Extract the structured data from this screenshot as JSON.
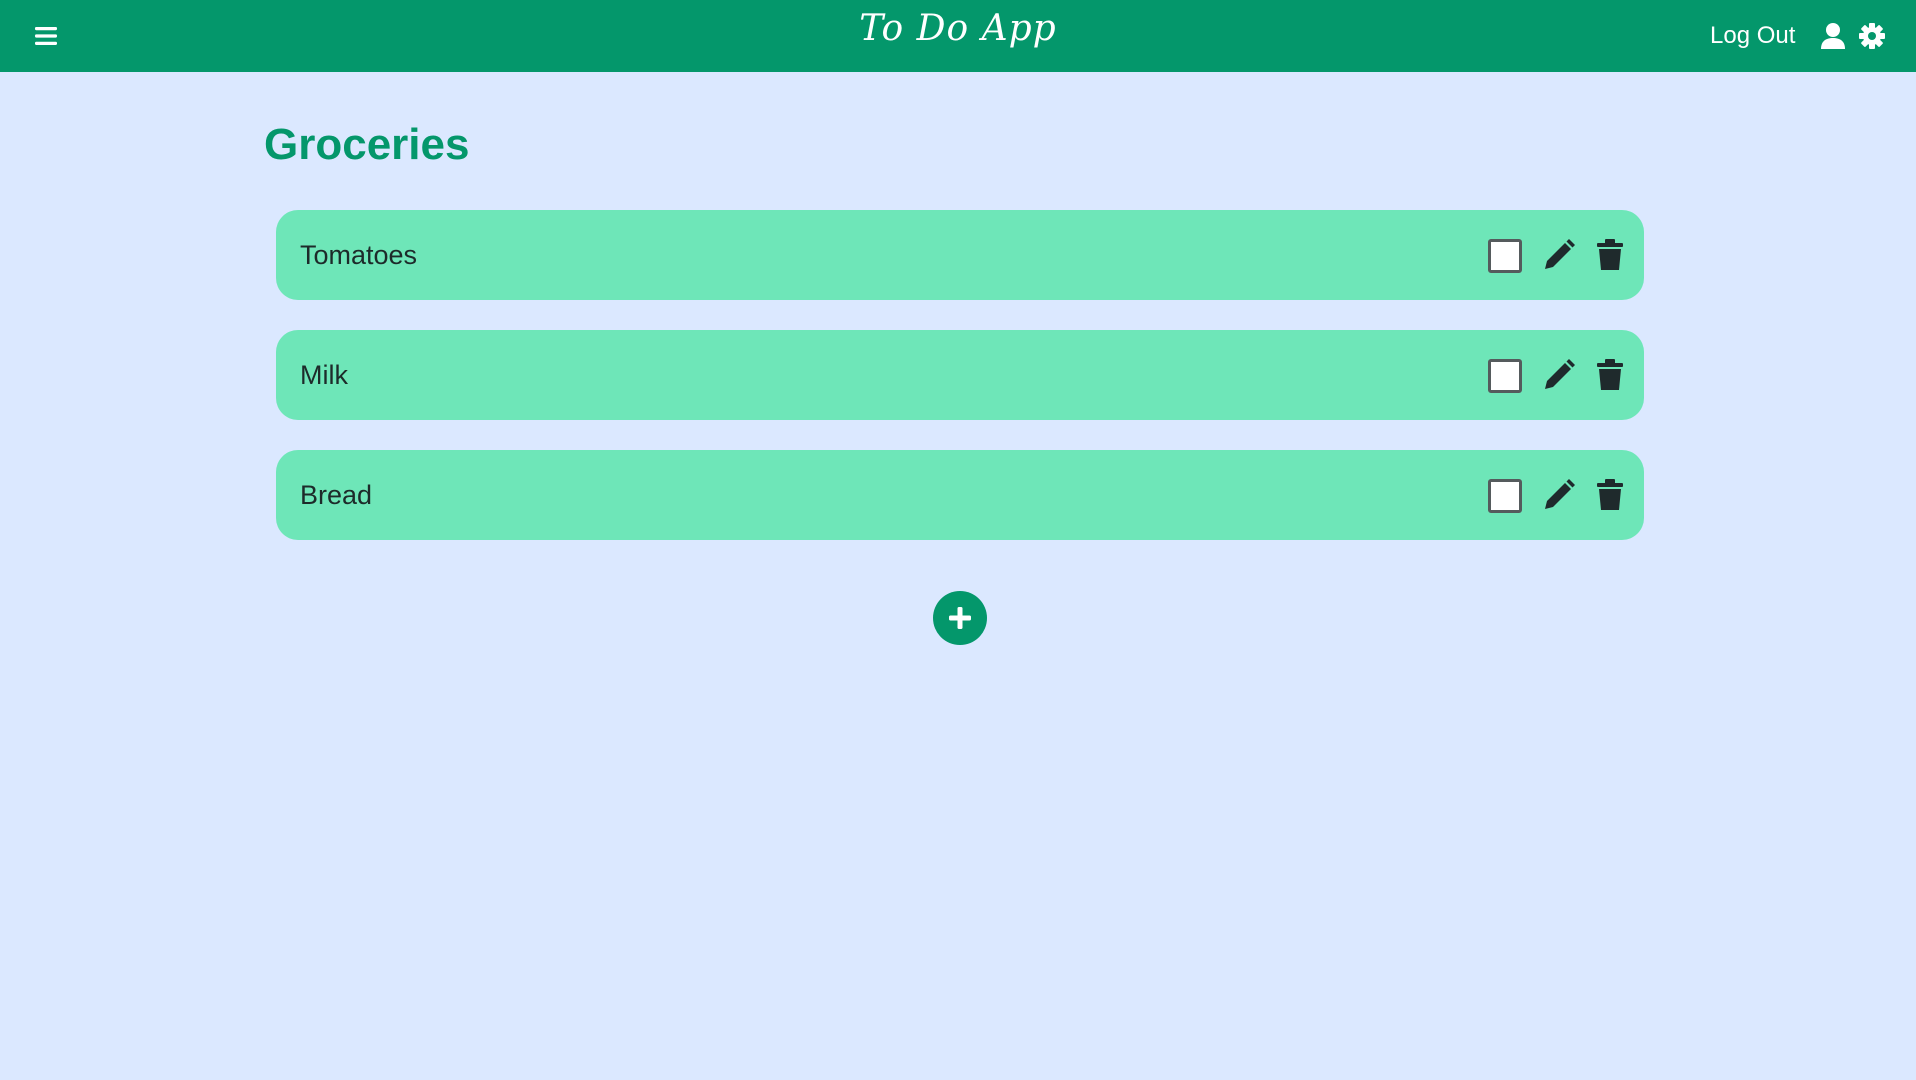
{
  "header": {
    "app_title": "To Do App",
    "logout_label": "Log Out",
    "icons": {
      "menu": "hamburger-menu-icon",
      "user": "user-icon",
      "settings": "gear-icon"
    }
  },
  "main": {
    "list_title": "Groceries",
    "tasks": [
      {
        "label": "Tomatoes",
        "checked": false
      },
      {
        "label": "Milk",
        "checked": false
      },
      {
        "label": "Bread",
        "checked": false
      }
    ],
    "task_icons": {
      "edit": "pencil-icon",
      "delete": "trash-icon"
    },
    "add_icon": "plus-icon"
  },
  "colors": {
    "header_bg": "#04976b",
    "page_bg": "#dbe8ff",
    "task_bg": "#6ee6b8",
    "title": "#04976b",
    "icon_dark": "#1f2a2c"
  }
}
